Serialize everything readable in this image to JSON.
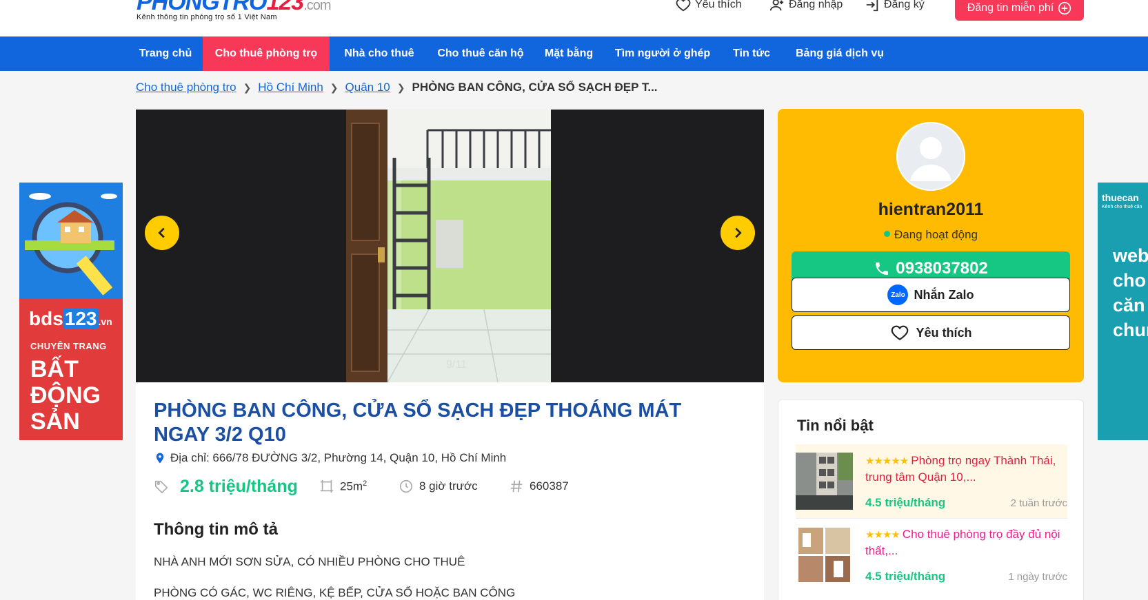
{
  "header": {
    "logo_text": "PHONGTRO",
    "logo_num": "123",
    "logo_domain": ".com",
    "tagline": "Kênh thông tin phòng trọ số 1 Việt Nam",
    "favorite": "Yêu thích",
    "login": "Đăng nhập",
    "register": "Đăng ký",
    "post_free": "Đăng tin miễn phí",
    "post_icon": "plus-circle-icon"
  },
  "nav": {
    "items": [
      "Trang chủ",
      "Cho thuê phòng trọ",
      "Nhà cho thuê",
      "Cho thuê căn hộ",
      "Mặt bằng",
      "Tìm người ở ghép",
      "Tin tức",
      "Bảng giá dịch vụ"
    ],
    "active_index": 1
  },
  "breadcrumb": {
    "items": [
      "Cho thuê phòng trọ",
      "Hồ Chí Minh",
      "Quận 10"
    ],
    "current": "PHÒNG BAN CÔNG, CỬA SỔ SẠCH ĐẸP T..."
  },
  "ad_left": {
    "brand": "bds",
    "brand_num": "123",
    "brand_suffix": ".vn",
    "line1": "CHUYÊN TRANG",
    "line2": "BẤT ĐỘNG SẢN"
  },
  "ad_right": {
    "brand": "thuecan",
    "tagline": "Kênh cho thuê căn",
    "lines": "web cho căn chun"
  },
  "gallery": {
    "counter": "9/11",
    "watermark": "PHONGTRO123"
  },
  "listing": {
    "title": "PHÒNG BAN CÔNG, CỬA SỔ SẠCH ĐẸP THOÁNG MÁT NGAY 3/2 Q10",
    "address": "Địa chỉ: 666/78 ĐƯỜNG 3/2, Phường 14, Quận 10, Hồ Chí Minh",
    "price": "2.8 triệu/tháng",
    "area": "25m",
    "area_sup": "2",
    "posted": "8 giờ trước",
    "id": "660387",
    "desc_heading": "Thông tin mô tả",
    "desc_line1": "NHÀ ANH MỚI SƠN SỬA, CÓ NHIỀU PHÒNG CHO THUÊ",
    "desc_line2": "PHÒNG CÓ GÁC, WC RIÊNG, KỆ BẾP, CỬA SỔ HOẶC BAN CÔNG"
  },
  "contact": {
    "username": "hientran2011",
    "status": "Đang hoạt động",
    "phone": "0938037802",
    "zalo_badge": "Zalo",
    "zalo_label": "Nhắn Zalo",
    "favorite_label": "Yêu thích"
  },
  "featured": {
    "heading": "Tin nổi bật",
    "items": [
      {
        "stars": "★★★★★",
        "title": "Phòng trọ ngay Thành Thái, trung tâm Quận 10,...",
        "price": "4.5 triệu/tháng",
        "time": "2 tuần trước",
        "color": "#e51f40"
      },
      {
        "stars": "★★★★",
        "title": "Cho thuê phòng trọ đầy đủ nội thất,...",
        "price": "4.5 triệu/tháng",
        "time": "1 ngày trước",
        "color": "#e91e8c"
      }
    ]
  },
  "colors": {
    "brand_blue": "#1266dd",
    "accent_red": "#f73859",
    "price_green": "#16c784",
    "contact_yellow": "#febb02"
  }
}
